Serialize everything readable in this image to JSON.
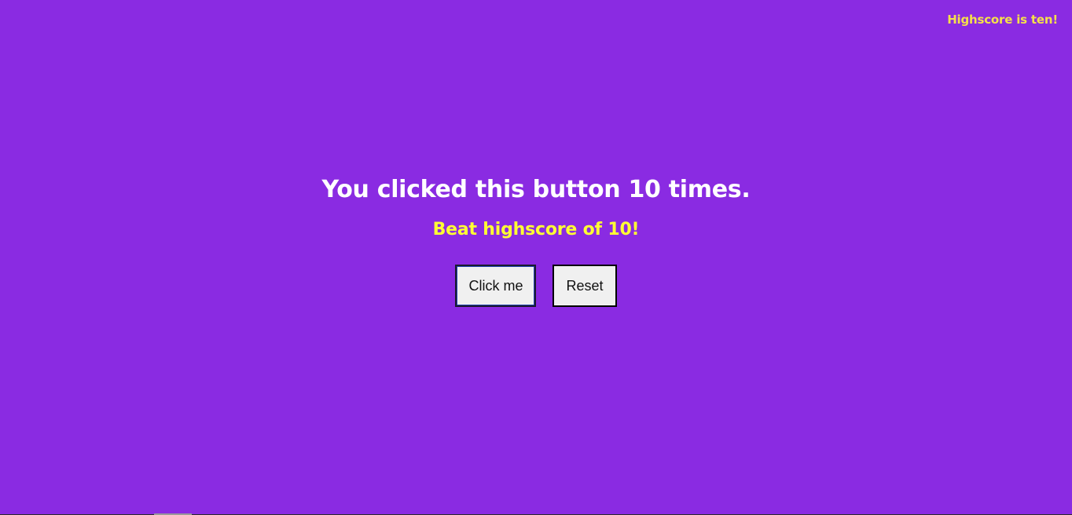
{
  "header": {
    "highscore_text": "Highscore is ten!"
  },
  "main": {
    "counter_text": "You clicked this button 10 times.",
    "beat_text": "Beat highscore of 10!",
    "click_button_label": "Click me",
    "reset_button_label": "Reset"
  },
  "colors": {
    "background": "#8a2be2",
    "highscore_corner": "#f5e04a",
    "beat_text": "#ffff33",
    "counter_text": "#ffffff"
  }
}
